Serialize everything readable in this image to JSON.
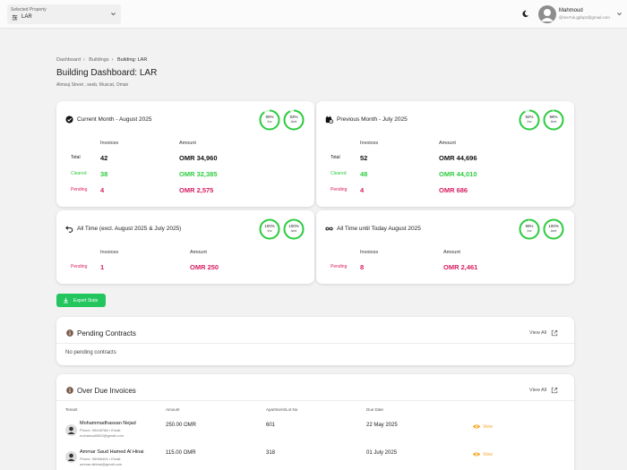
{
  "topbar": {
    "property_label": "Selected Property",
    "property_value": "LAR",
    "user_name": "Mahmoud",
    "user_email": "@me7uk.gpbp2@gmail.com"
  },
  "breadcrumb": [
    "Dashboard",
    "Buildings",
    "Building: LAR"
  ],
  "page": {
    "title": "Building Dashboard: LAR",
    "address": "Almouj Street , seeb, Muscat, Oman"
  },
  "colors": {
    "green": "#2ecc40",
    "pink": "#d81b60",
    "accent": "#22c55e",
    "orange": "#f5a623"
  },
  "stats": {
    "current": {
      "title": "Current Month - August 2025",
      "rings": [
        {
          "pct": "90%",
          "label": "Inv",
          "value": 0.9
        },
        {
          "pct": "93%",
          "label": "Amt",
          "value": 0.93
        }
      ],
      "col_invoices": "Invoices",
      "col_amount": "Amount",
      "rows": [
        {
          "label": "Total",
          "invoices": "42",
          "amount": "OMR 34,960"
        },
        {
          "label": "Cleared",
          "invoices": "38",
          "amount": "OMR 32,385"
        },
        {
          "label": "Pending",
          "invoices": "4",
          "amount": "OMR 2,575"
        }
      ]
    },
    "previous": {
      "title": "Previous Month - July 2025",
      "rings": [
        {
          "pct": "92%",
          "label": "Inv",
          "value": 0.92
        },
        {
          "pct": "98%",
          "label": "Amt",
          "value": 0.98
        }
      ],
      "col_invoices": "Invoices",
      "col_amount": "Amount",
      "rows": [
        {
          "label": "Total",
          "invoices": "52",
          "amount": "OMR 44,696"
        },
        {
          "label": "Cleared",
          "invoices": "48",
          "amount": "OMR 44,010"
        },
        {
          "label": "Pending",
          "invoices": "4",
          "amount": "OMR 686"
        }
      ]
    },
    "alltime_excl": {
      "title": "All Time (excl. August 2025 & July 2025)",
      "rings": [
        {
          "pct": "100%",
          "label": "Inv",
          "value": 1.0
        },
        {
          "pct": "100%",
          "label": "Amt",
          "value": 1.0
        }
      ],
      "col_invoices": "Invoices",
      "col_amount": "Amount",
      "rows": [
        {
          "label": "Pending",
          "invoices": "1",
          "amount": "OMR 250"
        }
      ]
    },
    "alltime_today": {
      "title": "All Time until Today August 2025",
      "rings": [
        {
          "pct": "99%",
          "label": "Inv",
          "value": 0.99
        },
        {
          "pct": "100%",
          "label": "Amt",
          "value": 1.0
        }
      ],
      "col_invoices": "Invoices",
      "col_amount": "Amount",
      "rows": [
        {
          "label": "Pending",
          "invoices": "8",
          "amount": "OMR 2,461"
        }
      ]
    }
  },
  "export_button": "Export Stats",
  "pending_contracts": {
    "title": "Pending Contracts",
    "view_all": "View All",
    "empty": "No pending contracts"
  },
  "overdue": {
    "title": "Over Due Invoices",
    "view_all": "View All",
    "columns": [
      "Tenant",
      "Amount",
      "Apartment/Lot No",
      "Due Date"
    ],
    "rows": [
      {
        "name": "Mohammadhassan Nejad",
        "phone": "Phone: 95446788 • Email:",
        "email": "mohamad3653@gmail.com",
        "amount": "250.00 OMR",
        "unit": "601",
        "due": "22 May 2025",
        "action": "View"
      },
      {
        "name": "Ammar Saud Hamed Al Hinai",
        "phone": "Phone: 96066404 • Email:",
        "email": "ammar.albinai@gmail.com",
        "amount": "115.00 OMR",
        "unit": "318",
        "due": "01 July 2025",
        "action": "View"
      }
    ]
  }
}
